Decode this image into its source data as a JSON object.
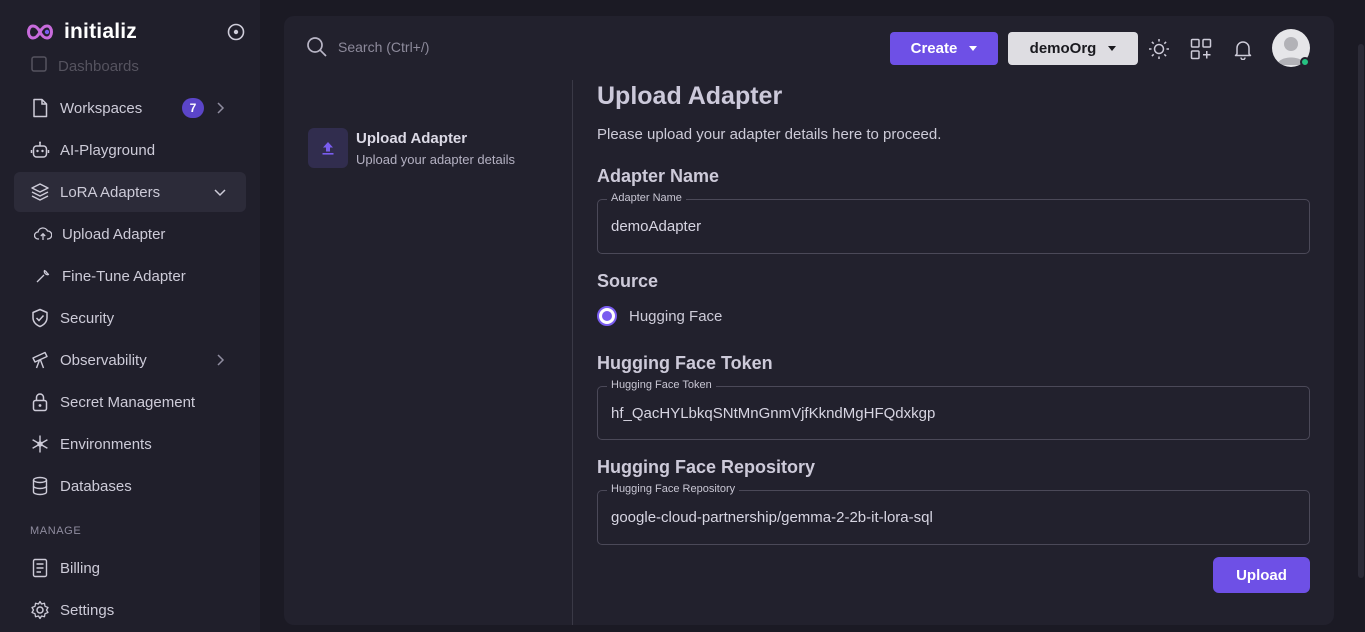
{
  "brand": {
    "name": "initializ"
  },
  "sidebar": {
    "faded_item": "Dashboards",
    "items": [
      {
        "label": "Workspaces",
        "badge": "7"
      },
      {
        "label": "AI-Playground"
      },
      {
        "label": "LoRA Adapters"
      },
      {
        "label": "Upload Adapter"
      },
      {
        "label": "Fine-Tune Adapter"
      },
      {
        "label": "Security"
      },
      {
        "label": "Observability"
      },
      {
        "label": "Secret Management"
      },
      {
        "label": "Environments"
      },
      {
        "label": "Databases"
      }
    ],
    "manage_label": "MANAGE",
    "manage_items": [
      {
        "label": "Billing"
      },
      {
        "label": "Settings"
      }
    ]
  },
  "header": {
    "search_placeholder": "Search (Ctrl+/)",
    "create_label": "Create",
    "org_label": "demoOrg"
  },
  "step": {
    "title": "Upload Adapter",
    "subtitle": "Upload your adapter details"
  },
  "form": {
    "title": "Upload Adapter",
    "description": "Please upload your adapter details here to proceed.",
    "adapter_name": {
      "heading": "Adapter Name",
      "legend": "Adapter Name",
      "value": "demoAdapter"
    },
    "source": {
      "heading": "Source",
      "option": "Hugging Face"
    },
    "token": {
      "heading": "Hugging Face Token",
      "legend": "Hugging Face Token",
      "value": "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"
    },
    "repository": {
      "heading": "Hugging Face Repository",
      "legend": "Hugging Face Repository",
      "value": "google-cloud-partnership/gemma-2-2b-it-lora-sql"
    },
    "upload_label": "Upload"
  },
  "colors": {
    "accent": "#6e50e6",
    "background": "#1b1a24",
    "card": "#22212d",
    "online": "#26c281"
  }
}
